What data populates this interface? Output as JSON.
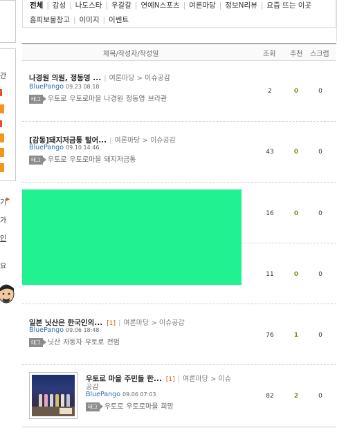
{
  "categories_row1": [
    "전체",
    "감성",
    "나도스타",
    "우갈갈",
    "연예N스포츠",
    "여론마당",
    "정보N리뷰",
    "요즘 뜨는 이곳"
  ],
  "categories_row2": [
    "홈피보물창고",
    "이미지",
    "이벤트"
  ],
  "sidebar_fragments": [
    "간",
    "기",
    "가",
    "인",
    "요"
  ],
  "table_header": {
    "title": "제목/작성자/작성일",
    "views": "조회",
    "recommend": "추천",
    "scrap": "스크랩"
  },
  "posts": [
    {
      "title": "나경원 의원, 정동영 ...",
      "comments": "",
      "category": "여론마당 > 이슈공감",
      "author": "BluePango",
      "date": "09.23 08:18",
      "tag_label": "태그",
      "tags": [
        "우토로",
        "우토로마을",
        "나경원",
        "정동영",
        "브라관"
      ],
      "views": "2",
      "recommend": "0",
      "scrap": "0"
    },
    {
      "title": "[감동]돼지저금통 털어...",
      "comments": "",
      "category": "여론마당 > 이슈공감",
      "author": "BluePango",
      "date": "09.10 14:46",
      "tag_label": "태그",
      "tags": [
        "우토로",
        "우토로마을",
        "돼지저금통"
      ],
      "views": "43",
      "recommend": "0",
      "scrap": "0"
    },
    {
      "title": "",
      "comments": "",
      "category": "",
      "author": "",
      "date": "",
      "tag_label": "",
      "tags": [],
      "views": "16",
      "recommend": "0",
      "scrap": "0"
    },
    {
      "title": "",
      "comments": "",
      "category": "",
      "author": "",
      "date": "",
      "tag_label": "",
      "tags": [],
      "views": "11",
      "recommend": "0",
      "scrap": "0"
    },
    {
      "title": "일본 닛산은 한국인의...",
      "comments": "[1]",
      "category": "여론마당 > 이슈공감",
      "author": "BluePango",
      "date": "09.06 18:48",
      "tag_label": "태그",
      "tags": [
        "닛산",
        "자동차",
        "우토로",
        "전범"
      ],
      "views": "76",
      "recommend": "1",
      "scrap": "0"
    },
    {
      "title": "우토로 마을 주민들 한...",
      "comments": "[1]",
      "category": "여론마당 > 이슈",
      "category_line2": "공감",
      "author": "BluePango",
      "date": "09.06 07:03",
      "tag_label": "태그",
      "tags": [
        "우토로",
        "우토로마을",
        "희망"
      ],
      "views": "82",
      "recommend": "2",
      "scrap": "0"
    }
  ],
  "colors": {
    "accent_green": "#22f191",
    "author_blue": "#2b6cb0",
    "recommend_green": "#6a9a1a",
    "orange": "#f7941d"
  }
}
